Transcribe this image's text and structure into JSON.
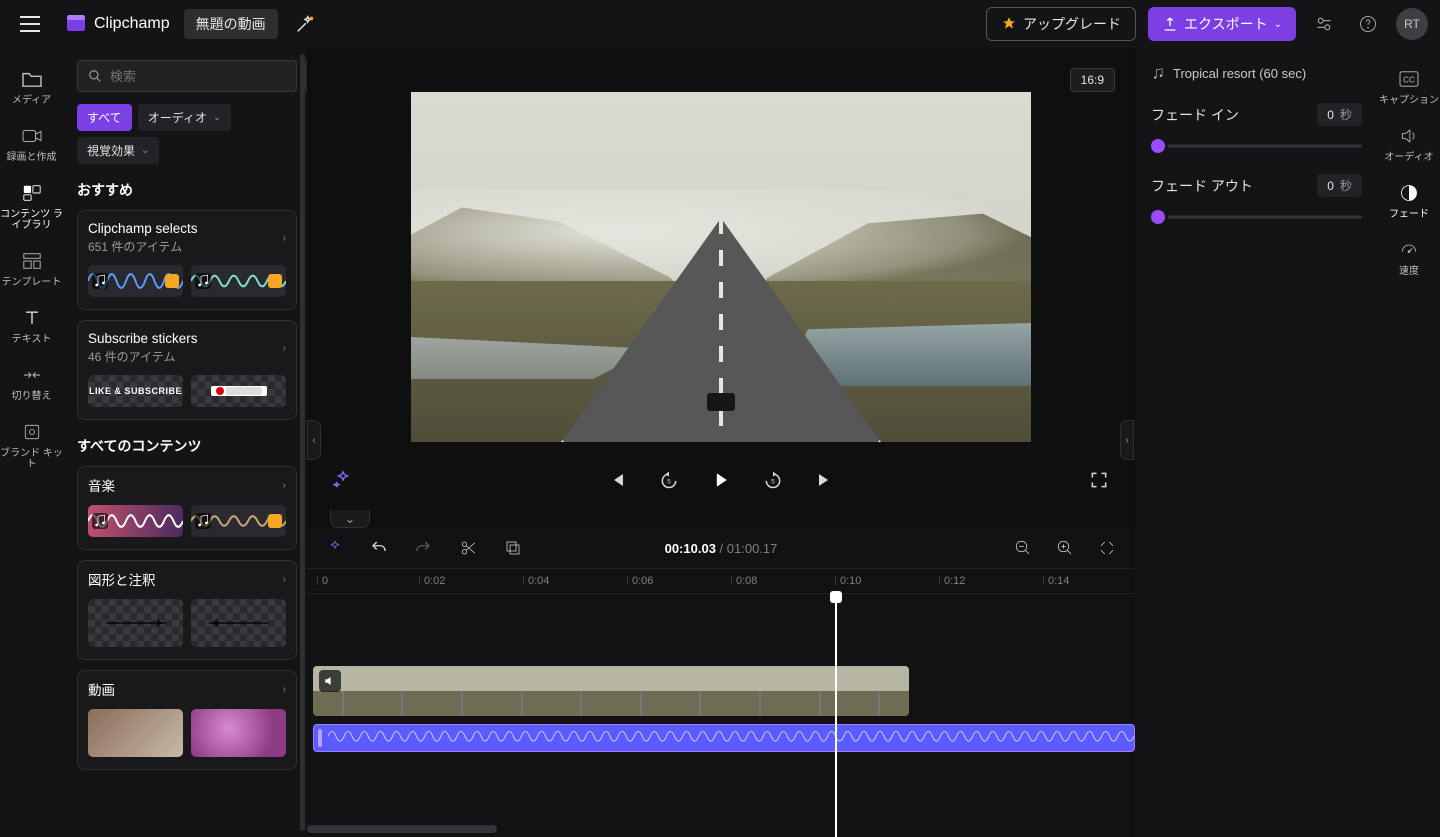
{
  "app": {
    "name": "Clipchamp",
    "project_title": "無題の動画"
  },
  "topbar": {
    "upgrade": "アップグレード",
    "export": "エクスポート",
    "avatar": "RT"
  },
  "left_rail": {
    "media": "メディア",
    "record": "録画と作成",
    "library": "コンテンツ ライブラリ",
    "templates": "テンプレート",
    "text": "テキスト",
    "transitions": "切り替え",
    "brand": "ブランド キット"
  },
  "library": {
    "search_placeholder": "検索",
    "chip_all": "すべて",
    "chip_audio": "オーディオ",
    "chip_visual": "視覚効果",
    "section_featured": "おすすめ",
    "section_all": "すべてのコンテンツ",
    "packs": {
      "selects": {
        "title": "Clipchamp selects",
        "sub": "651 件のアイテム"
      },
      "stickers": {
        "title": "Subscribe stickers",
        "sub": "46 件のアイテム",
        "thumb_label": "LIKE & SUBSCRIBE"
      }
    },
    "cats": {
      "music": "音楽",
      "shapes": "図形と注釈",
      "video": "動画"
    }
  },
  "preview": {
    "aspect": "16:9"
  },
  "timeline": {
    "current": "00:10.03",
    "total": "01:00.17",
    "ticks": [
      "0",
      "0:02",
      "0:04",
      "0:06",
      "0:08",
      "0:10",
      "0:12",
      "0:14"
    ]
  },
  "props": {
    "clip": "Tropical resort (60 sec)",
    "fade_in_label": "フェード イン",
    "fade_out_label": "フェード アウト",
    "fade_in_value": "0",
    "fade_out_value": "0",
    "unit": "秒"
  },
  "right_rail": {
    "captions": "キャプション",
    "audio": "オーディオ",
    "fade": "フェード",
    "speed": "速度"
  }
}
